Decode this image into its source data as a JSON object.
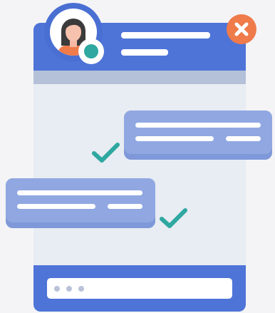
{
  "window": {
    "close_icon": "close-icon",
    "profile_avatar_icon": "woman-avatar-icon",
    "online_status": "online"
  },
  "messages": [
    {
      "side": "outgoing",
      "status_icon": "check-icon"
    },
    {
      "side": "incoming",
      "status_icon": "check-icon"
    }
  ],
  "composer": {
    "typing_indicator": "three-dots-icon"
  },
  "colors": {
    "primary": "#4e74d8",
    "accent_close": "#ef7a4a",
    "status_teal": "#2ea8a0",
    "bubble": "#90a7e2",
    "background": "#e8ecf3"
  }
}
